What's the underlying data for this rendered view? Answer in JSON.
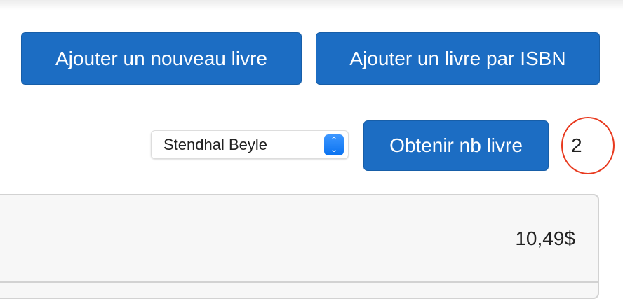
{
  "actions": {
    "add_new_book": "Ajouter un nouveau livre",
    "add_by_isbn": "Ajouter un livre par ISBN",
    "get_book_count": "Obtenir nb livre"
  },
  "author_select": {
    "value": "Stendhal Beyle"
  },
  "book_count": "2",
  "card": {
    "price": "10,49$"
  },
  "colors": {
    "primary": "#1c6dc3",
    "highlight_circle": "#e8391e"
  }
}
